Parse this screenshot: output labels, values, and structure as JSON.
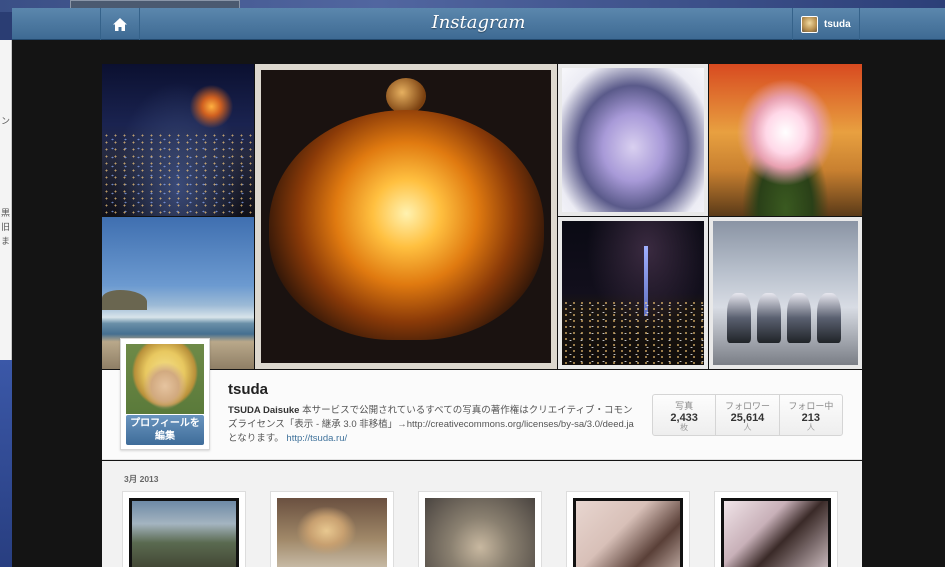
{
  "app": {
    "logo": "Instagram",
    "username": "tsuda"
  },
  "background_window": {
    "fragments": [
      "ン",
      "黒",
      "旧",
      "ま"
    ]
  },
  "cover": {
    "photos": [
      "night-city-tokyo-tower",
      "beach",
      "chandelier",
      "snow-tree",
      "flower-arrangement",
      "skytree-night",
      "robots"
    ]
  },
  "profile": {
    "username": "tsuda",
    "edit_button_line1": "プロフィールを",
    "edit_button_line2": "編集",
    "bio_name": "TSUDA Daisuke",
    "bio_text": " 本サービスで公開されているすべての写真の著作権はクリエイティブ・コモンズライセンス「表示 - 継承 3.0 非移植」→http://creativecommons.org/licenses/by-sa/3.0/deed.ja となります。 ",
    "bio_link": "http://tsuda.ru/",
    "stats": [
      {
        "label": "写真",
        "value": "2,433",
        "unit": "枚"
      },
      {
        "label": "フォロワー",
        "value": "25,614",
        "unit": "人"
      },
      {
        "label": "フォロー中",
        "value": "213",
        "unit": "人"
      }
    ]
  },
  "feed": {
    "month_label": "3月 2013",
    "thumbnails": [
      "shrine-gate",
      "person-waving",
      "foggy-sky",
      "cherry-blossom-1",
      "cherry-blossom-2"
    ]
  },
  "colors": {
    "topbar": "#4a7aa3",
    "link": "#3f729b",
    "edit_button": "#4f7eac"
  }
}
